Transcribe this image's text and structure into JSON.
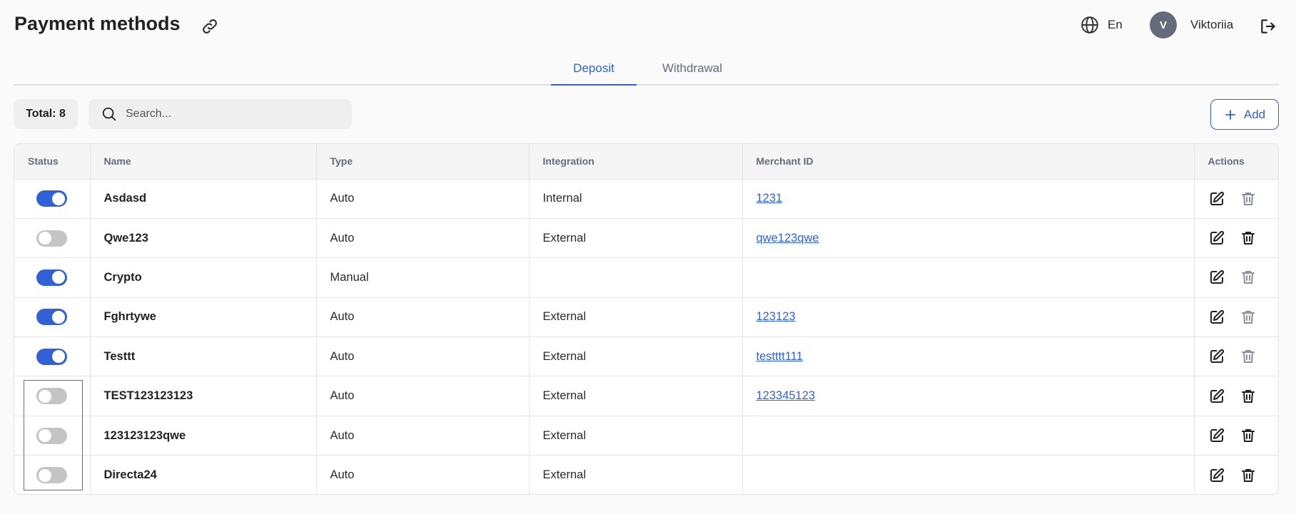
{
  "page": {
    "title": "Payment methods"
  },
  "header": {
    "language": "En",
    "avatar_letter": "V",
    "username": "Viktoriia"
  },
  "tabs": [
    {
      "label": "Deposit",
      "active": true
    },
    {
      "label": "Withdrawal",
      "active": false
    }
  ],
  "toolbar": {
    "total_label": "Total: 8",
    "search_placeholder": "Search...",
    "add_label": "Add"
  },
  "table": {
    "columns": [
      "Status",
      "Name",
      "Type",
      "Integration",
      "Merchant ID",
      "Actions"
    ],
    "rows": [
      {
        "enabled": true,
        "name": "Asdasd",
        "type": "Auto",
        "integration": "Internal",
        "merchant_id": "1231",
        "delete_enabled": false
      },
      {
        "enabled": false,
        "name": "Qwe123",
        "type": "Auto",
        "integration": "External",
        "merchant_id": "qwe123qwe",
        "delete_enabled": true
      },
      {
        "enabled": true,
        "name": "Crypto",
        "type": "Manual",
        "integration": "",
        "merchant_id": "",
        "delete_enabled": false
      },
      {
        "enabled": true,
        "name": "Fghrtywe",
        "type": "Auto",
        "integration": "External",
        "merchant_id": "123123",
        "delete_enabled": false
      },
      {
        "enabled": true,
        "name": "Testtt",
        "type": "Auto",
        "integration": "External",
        "merchant_id": "testttt111",
        "delete_enabled": false
      },
      {
        "enabled": false,
        "name": "TEST123123123",
        "type": "Auto",
        "integration": "External",
        "merchant_id": "123345123",
        "delete_enabled": true
      },
      {
        "enabled": false,
        "name": "123123123qwe",
        "type": "Auto",
        "integration": "External",
        "merchant_id": "",
        "delete_enabled": true
      },
      {
        "enabled": false,
        "name": "Directa24",
        "type": "Auto",
        "integration": "External",
        "merchant_id": "",
        "delete_enabled": true
      }
    ]
  },
  "colors": {
    "accent": "#3161d6",
    "toggle_off": "#c4c4c4",
    "highlight": "#e03c3c"
  }
}
